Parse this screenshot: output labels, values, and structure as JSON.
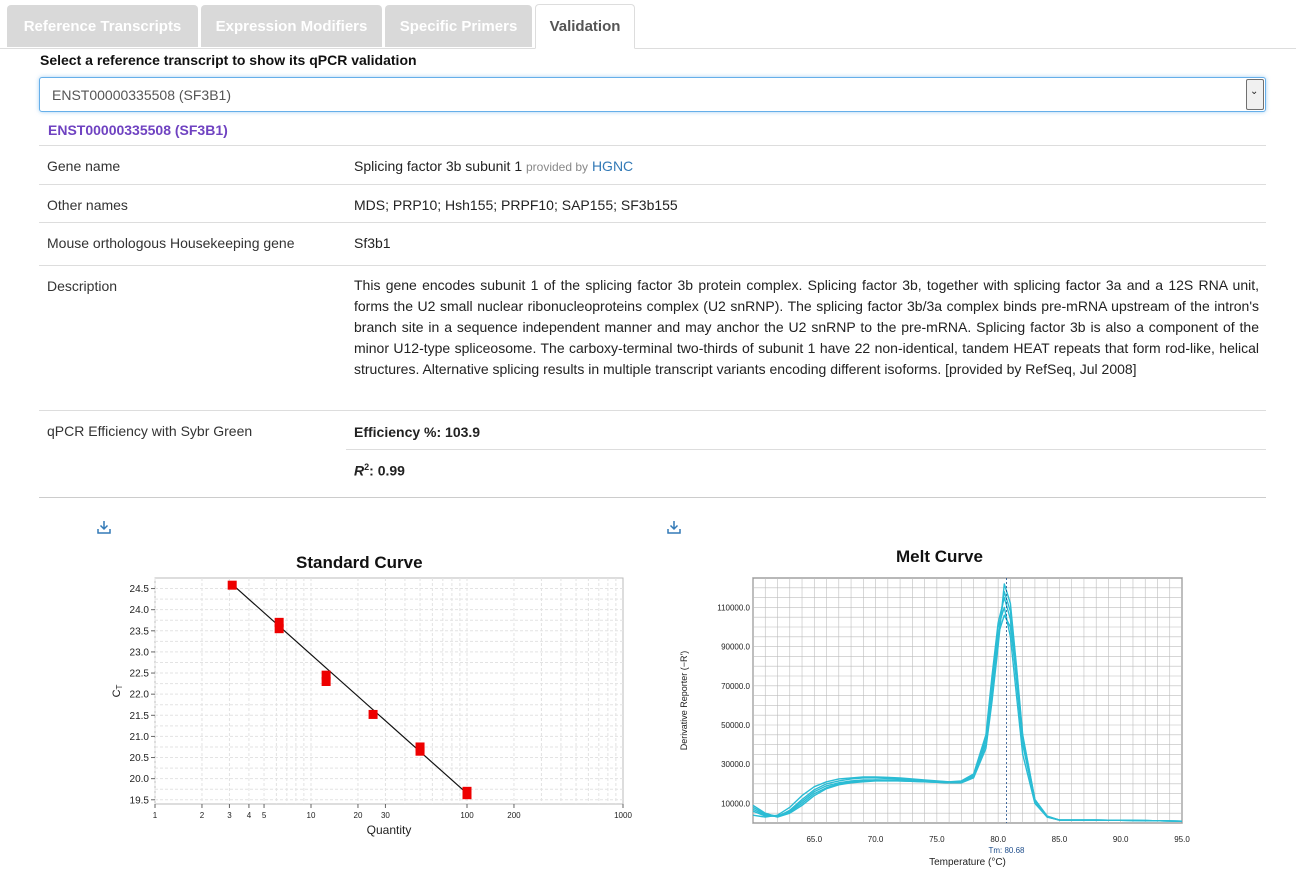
{
  "tabs": [
    {
      "label": "Reference Transcripts"
    },
    {
      "label": "Expression Modifiers"
    },
    {
      "label": "Specific Primers"
    },
    {
      "label": "Validation"
    }
  ],
  "select": {
    "label": "Select a reference transcript to show its qPCR validation",
    "value": "ENST00000335508 (SF3B1)"
  },
  "transcript_title": "ENST00000335508 (SF3B1)",
  "info": {
    "gene_name_key": "Gene name",
    "gene_name_val": "Splicing factor 3b subunit 1",
    "provided_by": "provided by",
    "hgnc": "HGNC",
    "other_names_key": "Other names",
    "other_names_val": "MDS; PRP10; Hsh155; PRPF10; SAP155; SF3b155",
    "mouse_key": "Mouse orthologous Housekeeping gene",
    "mouse_val": "Sf3b1",
    "description_key": "Description",
    "description_val": "This gene encodes subunit 1 of the splicing factor 3b protein complex. Splicing factor 3b, together with splicing factor 3a and a 12S RNA unit, forms the U2 small nuclear ribonucleoproteins complex (U2 snRNP). The splicing factor 3b/3a complex binds pre-mRNA upstream of the intron's branch site in a sequence independent manner and may anchor the U2 snRNP to the pre-mRNA. Splicing factor 3b is also a component of the minor U12-type spliceosome. The carboxy-terminal two-thirds of subunit 1 have 22 non-identical, tandem HEAT repeats that form rod-like, helical structures. Alternative splicing results in multiple transcript variants encoding different isoforms. [provided by RefSeq, Jul 2008]",
    "qpcr_key": "qPCR Efficiency with Sybr Green",
    "efficiency": "Efficiency %: 103.9",
    "r2_label": "R",
    "r2_sup": "2",
    "r2_value": ": 0.99"
  },
  "chart_data": [
    {
      "type": "scatter",
      "title": "Standard Curve",
      "xlabel": "Quantity",
      "ylabel": "CT",
      "xscale": "log",
      "xlim": [
        1,
        1000
      ],
      "ylim": [
        19.4,
        24.75
      ],
      "xticks": [
        1,
        2,
        3,
        4,
        5,
        10,
        20,
        30,
        100,
        200,
        1000
      ],
      "yticks": [
        19.5,
        20.0,
        20.5,
        21.0,
        21.5,
        22.0,
        22.5,
        23.0,
        23.5,
        24.0,
        24.5
      ],
      "points": [
        {
          "x": 3.125,
          "y": 24.58
        },
        {
          "x": 6.25,
          "y": 23.7
        },
        {
          "x": 6.25,
          "y": 23.55
        },
        {
          "x": 12.5,
          "y": 22.45
        },
        {
          "x": 12.5,
          "y": 22.3
        },
        {
          "x": 25,
          "y": 21.52
        },
        {
          "x": 50,
          "y": 20.75
        },
        {
          "x": 50,
          "y": 20.65
        },
        {
          "x": 100,
          "y": 19.7
        },
        {
          "x": 100,
          "y": 19.62
        }
      ],
      "fit": [
        {
          "x": 3.125,
          "y": 24.6
        },
        {
          "x": 100,
          "y": 19.65
        }
      ],
      "grid": true,
      "marker_color": "#ee0000"
    },
    {
      "type": "line",
      "title": "Melt Curve",
      "xlabel": "Temperature (°C)",
      "ylabel": "Derivative Reporter (−R')",
      "xlim": [
        60,
        95
      ],
      "ylim": [
        0,
        125000
      ],
      "xticks": [
        65.0,
        70.0,
        75.0,
        80.0,
        85.0,
        90.0,
        95.0
      ],
      "yticks": [
        10000.0,
        30000.0,
        50000.0,
        70000.0,
        90000.0,
        110000.0
      ],
      "tm_label": "Tm: 80.68",
      "tm": 80.68,
      "line_color": "#2bbcd4",
      "series": [
        {
          "x": [
            60,
            61,
            62,
            63,
            64,
            65,
            66,
            67,
            68,
            69,
            70,
            72,
            74,
            76,
            77,
            78,
            79,
            79.5,
            80,
            80.5,
            81,
            81.5,
            82,
            83,
            84,
            85,
            88,
            92,
            95
          ],
          "values": [
            6000,
            3500,
            3500,
            6000,
            11000,
            16000,
            19000,
            20500,
            21500,
            22000,
            22000,
            21500,
            21000,
            20500,
            21000,
            24000,
            42000,
            70000,
            100000,
            110000,
            95000,
            65000,
            35000,
            10000,
            3000,
            1500,
            1500,
            1200,
            900
          ]
        },
        {
          "x": [
            60,
            61,
            62,
            63,
            64,
            65,
            66,
            67,
            68,
            69,
            70,
            72,
            74,
            76,
            77,
            78,
            79,
            79.5,
            80,
            80.5,
            81,
            81.5,
            82,
            83,
            84,
            85,
            88,
            92,
            95
          ],
          "values": [
            9000,
            5000,
            3000,
            5000,
            9000,
            14000,
            17500,
            19500,
            20500,
            21000,
            21500,
            21500,
            21000,
            20500,
            20500,
            23000,
            38000,
            62000,
            90000,
            122000,
            112000,
            80000,
            45000,
            12000,
            3500,
            1500,
            1500,
            1200,
            900
          ]
        },
        {
          "x": [
            60,
            61,
            62,
            63,
            64,
            65,
            66,
            67,
            68,
            69,
            70,
            72,
            74,
            76,
            77,
            78,
            79,
            79.5,
            80,
            80.5,
            81,
            81.5,
            82,
            83,
            84,
            85,
            88,
            92,
            95
          ],
          "values": [
            4000,
            3000,
            4000,
            8000,
            14000,
            18500,
            21000,
            22500,
            23000,
            23500,
            23500,
            23000,
            22000,
            21000,
            21500,
            25000,
            45000,
            75000,
            102000,
            115000,
            104000,
            72000,
            40000,
            11000,
            3000,
            1500,
            1500,
            1200,
            900
          ]
        },
        {
          "x": [
            60,
            61,
            62,
            63,
            64,
            65,
            66,
            67,
            68,
            69,
            70,
            72,
            74,
            76,
            77,
            78,
            79,
            79.5,
            80,
            80.5,
            81,
            81.5,
            82,
            83,
            84,
            85,
            88,
            92,
            95
          ],
          "values": [
            7000,
            4000,
            3200,
            6500,
            12000,
            17000,
            20000,
            21500,
            22500,
            23000,
            23000,
            22500,
            21500,
            20500,
            21000,
            24500,
            43000,
            68000,
            96000,
            106000,
            100000,
            75000,
            42000,
            11500,
            3200,
            1500,
            1500,
            1200,
            900
          ]
        },
        {
          "x": [
            60,
            61,
            62,
            63,
            64,
            65,
            66,
            67,
            68,
            69,
            70,
            72,
            74,
            76,
            77,
            78,
            79,
            79.5,
            80,
            80.5,
            81,
            81.5,
            82,
            83,
            84,
            85,
            88,
            92,
            95
          ],
          "values": [
            8000,
            4500,
            3500,
            5500,
            10000,
            15000,
            18000,
            20000,
            21000,
            21500,
            22000,
            22000,
            21500,
            21000,
            21000,
            23500,
            40000,
            66000,
            94000,
            118000,
            108000,
            78000,
            44000,
            12000,
            3300,
            1500,
            1500,
            1200,
            900
          ]
        }
      ]
    }
  ]
}
